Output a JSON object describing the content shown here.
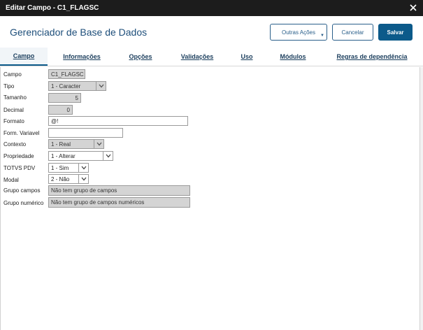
{
  "window": {
    "title": "Editar Campo - C1_FLAGSC"
  },
  "header": {
    "app_title": "Gerenciador de Base de Dados",
    "buttons": {
      "outras": "Outras Ações",
      "cancelar": "Cancelar",
      "salvar": "Salvar"
    }
  },
  "tabs": [
    "Campo",
    "Informações",
    "Opções",
    "Validações",
    "Uso",
    "Módulos",
    "Regras de dependência"
  ],
  "active_tab": "Campo",
  "fields": {
    "campo": {
      "label": "Campo",
      "value": "C1_FLAGSC"
    },
    "tipo": {
      "label": "Tipo",
      "value": "1 - Caracter"
    },
    "tamanho": {
      "label": "Tamanho",
      "value": "5"
    },
    "decimal": {
      "label": "Decimal",
      "value": "0"
    },
    "formato": {
      "label": "Formato",
      "value": "@!"
    },
    "form_variavel": {
      "label": "Form. Variavel",
      "value": ""
    },
    "contexto": {
      "label": "Contexto",
      "value": "1 - Real"
    },
    "propriedade": {
      "label": "Propriedade",
      "value": "1 - Alterar"
    },
    "totvs_pdv": {
      "label": "TOTVS PDV",
      "value": "1 - Sim"
    },
    "modal": {
      "label": "Modal",
      "value": "2 - Não"
    },
    "grupo_campos": {
      "label": "Grupo campos",
      "value": "Não tem grupo de campos"
    },
    "grupo_numerico": {
      "label": "Grupo numérico",
      "value": "Não tem grupo de campos numéricos"
    }
  },
  "colors": {
    "titlebar": "#1c1c1c",
    "accent": "#0c5a8a",
    "title_text": "#1d4e7a",
    "readonly": "#d4d4d4"
  }
}
